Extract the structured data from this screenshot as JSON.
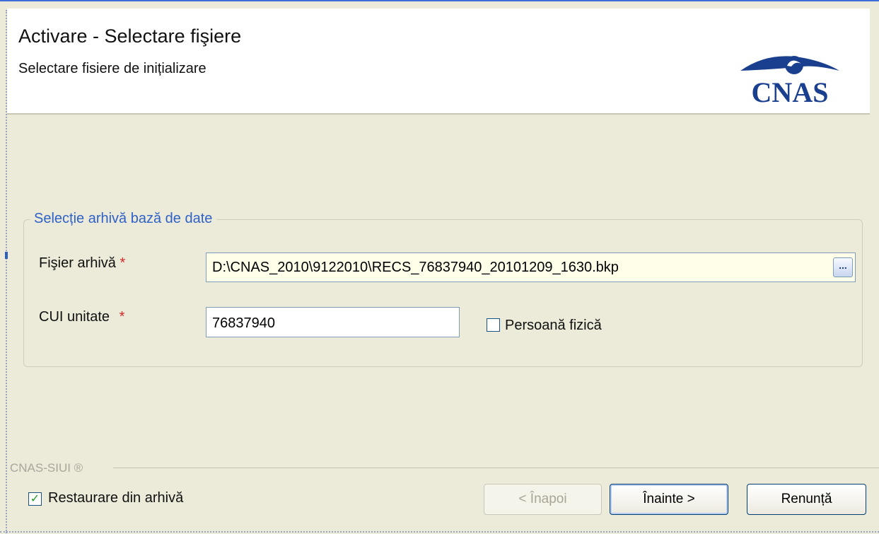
{
  "header": {
    "title": "Activare - Selectare fişiere",
    "subtitle": "Selectare fisiere de inițializare",
    "logo_text": "CNAS"
  },
  "group": {
    "legend": "Selecție arhivă bază de date",
    "file_label": "Fişier arhivă",
    "file_value": "D:\\CNAS_2010\\9122010\\RECS_76837940_20101209_1630.bkp",
    "browse_label": "...",
    "cui_label": "CUI unitate",
    "cui_value": "76837940",
    "required_mark": "*",
    "persoana_label": "Persoană fizică",
    "persoana_checked": false
  },
  "footer": {
    "brand": "CNAS-SIUI ®",
    "restore_label": "Restaurare din arhivă",
    "restore_checked": true,
    "back_label": "< Înapoi",
    "next_label": "Înainte >",
    "cancel_label": "Renunță"
  },
  "colors": {
    "background": "#ecead8",
    "legend": "#2f62c8",
    "required": "#d82a2a",
    "logo": "#1b3f8f"
  }
}
